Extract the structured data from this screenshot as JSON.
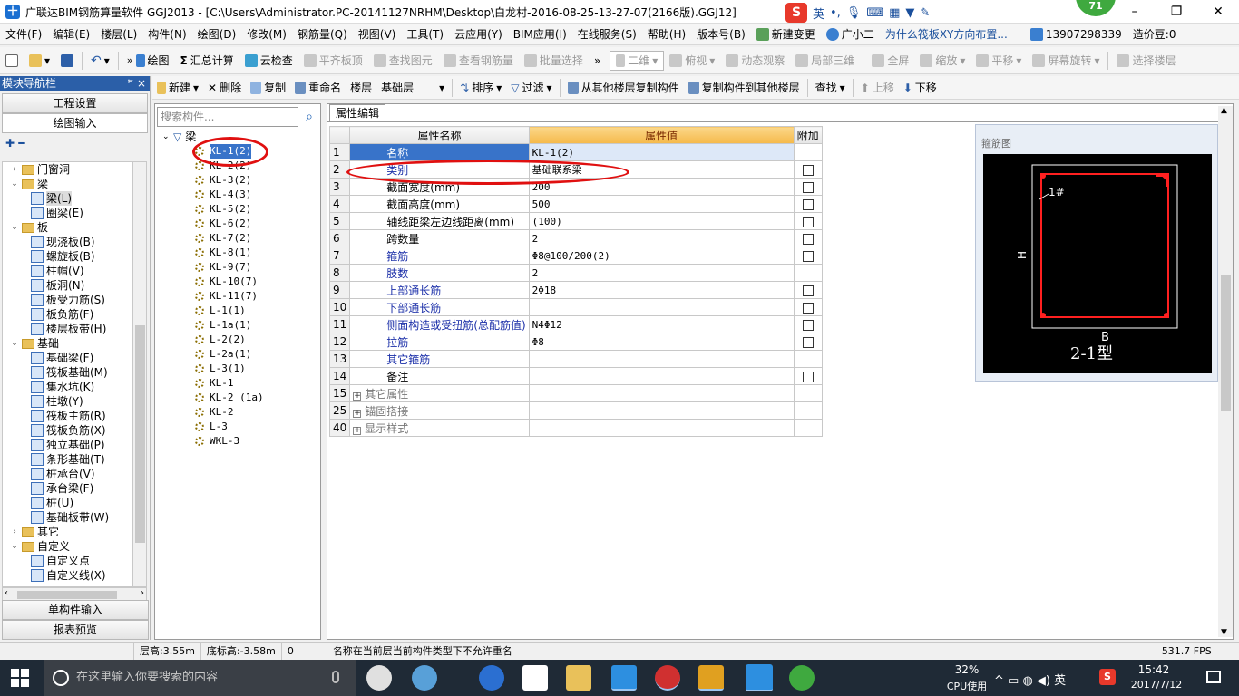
{
  "window": {
    "title": "广联达BIM钢筋算量软件 GGJ2013 - [C:\\Users\\Administrator.PC-20141127NRHM\\Desktop\\白龙村-2016-08-25-13-27-07(2166版).GGJ12]",
    "app_icon": "十",
    "badge": "71",
    "ime": {
      "logo": "S",
      "lang": "英"
    },
    "buttons": {
      "minimize": "–",
      "restore": "❐",
      "close": "✕"
    }
  },
  "menu": {
    "items": [
      "文件(F)",
      "编辑(E)",
      "楼层(L)",
      "构件(N)",
      "绘图(D)",
      "修改(M)",
      "钢筋量(Q)",
      "视图(V)",
      "工具(T)",
      "云应用(Y)",
      "BIM应用(I)",
      "在线服务(S)",
      "帮助(H)",
      "版本号(B)"
    ],
    "new_change": "新建变更",
    "assistant": "广小二",
    "question": "为什么筏板XY方向布置...",
    "phone": "13907298339",
    "beans": "造价豆:0"
  },
  "toolbar1": {
    "draw": "绘图",
    "summary": "汇总计算",
    "cloud_check": "云检查",
    "flush_slab": "平齐板顶",
    "find_element": "查找图元",
    "view_rebar": "查看钢筋量",
    "batch_select": "批量选择",
    "view_mode": "二维",
    "top_view": "俯视",
    "dynamic_view": "动态观察",
    "local_3d": "局部三维",
    "fullscreen": "全屏",
    "zoom": "缩放",
    "pan": "平移",
    "rotate": "屏幕旋转",
    "select_floor": "选择楼层"
  },
  "toolbar2": {
    "new": "新建",
    "delete": "删除",
    "copy": "复制",
    "rename": "重命名",
    "floor_label": "楼层",
    "floor_value": "基础层",
    "sort": "排序",
    "filter": "过滤",
    "copy_from": "从其他楼层复制构件",
    "copy_to": "复制构件到其他楼层",
    "find": "查找",
    "move_up": "上移",
    "move_down": "下移"
  },
  "nav": {
    "header": "模块导航栏",
    "pin": "ꟸ ×",
    "project_settings": "工程设置",
    "drawing_input": "绘图输入",
    "single_input": "单构件输入",
    "report_preview": "报表预览",
    "tree_tools": "✚ ━",
    "tree": [
      {
        "label": "门窗洞",
        "level": 0,
        "expand": "›",
        "type": "folder"
      },
      {
        "label": "梁",
        "level": 0,
        "expand": "⌄",
        "type": "folder"
      },
      {
        "label": "梁(L)",
        "level": 1,
        "expand": "",
        "type": "item",
        "sel": true
      },
      {
        "label": "圈梁(E)",
        "level": 1,
        "expand": "",
        "type": "item"
      },
      {
        "label": "板",
        "level": 0,
        "expand": "⌄",
        "type": "folder"
      },
      {
        "label": "现浇板(B)",
        "level": 1,
        "expand": "",
        "type": "item"
      },
      {
        "label": "螺旋板(B)",
        "level": 1,
        "expand": "",
        "type": "item"
      },
      {
        "label": "柱帽(V)",
        "level": 1,
        "expand": "",
        "type": "item"
      },
      {
        "label": "板洞(N)",
        "level": 1,
        "expand": "",
        "type": "item"
      },
      {
        "label": "板受力筋(S)",
        "level": 1,
        "expand": "",
        "type": "item"
      },
      {
        "label": "板负筋(F)",
        "level": 1,
        "expand": "",
        "type": "item"
      },
      {
        "label": "楼层板带(H)",
        "level": 1,
        "expand": "",
        "type": "item"
      },
      {
        "label": "基础",
        "level": 0,
        "expand": "⌄",
        "type": "folder"
      },
      {
        "label": "基础梁(F)",
        "level": 1,
        "expand": "",
        "type": "item"
      },
      {
        "label": "筏板基础(M)",
        "level": 1,
        "expand": "",
        "type": "item"
      },
      {
        "label": "集水坑(K)",
        "level": 1,
        "expand": "",
        "type": "item"
      },
      {
        "label": "柱墩(Y)",
        "level": 1,
        "expand": "",
        "type": "item"
      },
      {
        "label": "筏板主筋(R)",
        "level": 1,
        "expand": "",
        "type": "item"
      },
      {
        "label": "筏板负筋(X)",
        "level": 1,
        "expand": "",
        "type": "item"
      },
      {
        "label": "独立基础(P)",
        "level": 1,
        "expand": "",
        "type": "item"
      },
      {
        "label": "条形基础(T)",
        "level": 1,
        "expand": "",
        "type": "item"
      },
      {
        "label": "桩承台(V)",
        "level": 1,
        "expand": "",
        "type": "item"
      },
      {
        "label": "承台梁(F)",
        "level": 1,
        "expand": "",
        "type": "item"
      },
      {
        "label": "桩(U)",
        "level": 1,
        "expand": "",
        "type": "item"
      },
      {
        "label": "基础板带(W)",
        "level": 1,
        "expand": "",
        "type": "item"
      },
      {
        "label": "其它",
        "level": 0,
        "expand": "›",
        "type": "folder"
      },
      {
        "label": "自定义",
        "level": 0,
        "expand": "⌄",
        "type": "folder"
      },
      {
        "label": "自定义点",
        "level": 1,
        "expand": "",
        "type": "item"
      },
      {
        "label": "自定义线(X)",
        "level": 1,
        "expand": "",
        "type": "item"
      }
    ]
  },
  "components": {
    "search_placeholder": "搜索构件...",
    "root": "梁",
    "items": [
      "KL-1(2)",
      "KL-2(2)",
      "KL-3(2)",
      "KL-4(3)",
      "KL-5(2)",
      "KL-6(2)",
      "KL-7(2)",
      "KL-8(1)",
      "KL-9(7)",
      "KL-10(7)",
      "KL-11(7)",
      "L-1(1)",
      "L-1a(1)",
      "L-2(2)",
      "L-2a(1)",
      "L-3(1)",
      "KL-1",
      "KL-2 (1a)",
      "KL-2",
      "L-3",
      "WKL-3"
    ]
  },
  "props": {
    "tab": "属性编辑",
    "headers": {
      "name": "属性名称",
      "value": "属性值",
      "extra": "附加"
    },
    "rows": [
      {
        "no": "1",
        "name": "名称",
        "value": "KL-1(2)",
        "style": "sel",
        "cb": false
      },
      {
        "no": "2",
        "name": "类别",
        "value": "基础联系梁",
        "style": "blue",
        "cb": true
      },
      {
        "no": "3",
        "name": "截面宽度(mm)",
        "value": "200",
        "style": "",
        "cb": true
      },
      {
        "no": "4",
        "name": "截面高度(mm)",
        "value": "500",
        "style": "",
        "cb": true
      },
      {
        "no": "5",
        "name": "轴线距梁左边线距离(mm)",
        "value": "(100)",
        "style": "",
        "cb": true
      },
      {
        "no": "6",
        "name": "跨数量",
        "value": "2",
        "style": "",
        "cb": true
      },
      {
        "no": "7",
        "name": "箍筋",
        "value": "Φ8@100/200(2)",
        "style": "blue",
        "cb": true
      },
      {
        "no": "8",
        "name": "肢数",
        "value": "2",
        "style": "blue",
        "cb": false
      },
      {
        "no": "9",
        "name": "上部通长筋",
        "value": "2Φ18",
        "style": "blue",
        "cb": true
      },
      {
        "no": "10",
        "name": "下部通长筋",
        "value": "",
        "style": "blue",
        "cb": true
      },
      {
        "no": "11",
        "name": "侧面构造或受扭筋(总配筋值)",
        "value": "N4Φ12",
        "style": "blue",
        "cb": true
      },
      {
        "no": "12",
        "name": "拉筋",
        "value": "Φ8",
        "style": "blue",
        "cb": true
      },
      {
        "no": "13",
        "name": "其它箍筋",
        "value": "",
        "style": "blue",
        "cb": false
      },
      {
        "no": "14",
        "name": "备注",
        "value": "",
        "style": "",
        "cb": true
      },
      {
        "no": "15",
        "name": "其它属性",
        "value": "",
        "style": "grey",
        "cb": false,
        "plus": true
      },
      {
        "no": "25",
        "name": "锚固搭接",
        "value": "",
        "style": "grey",
        "cb": false,
        "plus": true
      },
      {
        "no": "40",
        "name": "显示样式",
        "value": "",
        "style": "grey",
        "cb": false,
        "plus": true
      }
    ],
    "plus_sign": "+"
  },
  "stirrup": {
    "caption": "箍筋图",
    "label_1": "1#",
    "label_h": "H",
    "label_b": "B",
    "type_label": "2-1型"
  },
  "status": {
    "floor_height": "层高:3.55m",
    "bottom_height": "底标高:-3.58m",
    "zero": "0",
    "message": "名称在当前层当前构件类型下不允许重名",
    "fps": "531.7 FPS"
  },
  "taskbar": {
    "search_placeholder": "在这里输入你要搜索的内容",
    "cpu_percent": "32%",
    "cpu_label": "CPU使用",
    "tray_text": "^ ▭ ◍ ◀) 英",
    "lang": "英",
    "time": "15:42",
    "date": "2017/7/12"
  },
  "colors": {
    "accent": "#3873c9",
    "header_value": "#f5b94a",
    "annotation_red": "#e01010",
    "stirrup_red": "#ff2020",
    "nav_header": "#2b5fa8"
  }
}
